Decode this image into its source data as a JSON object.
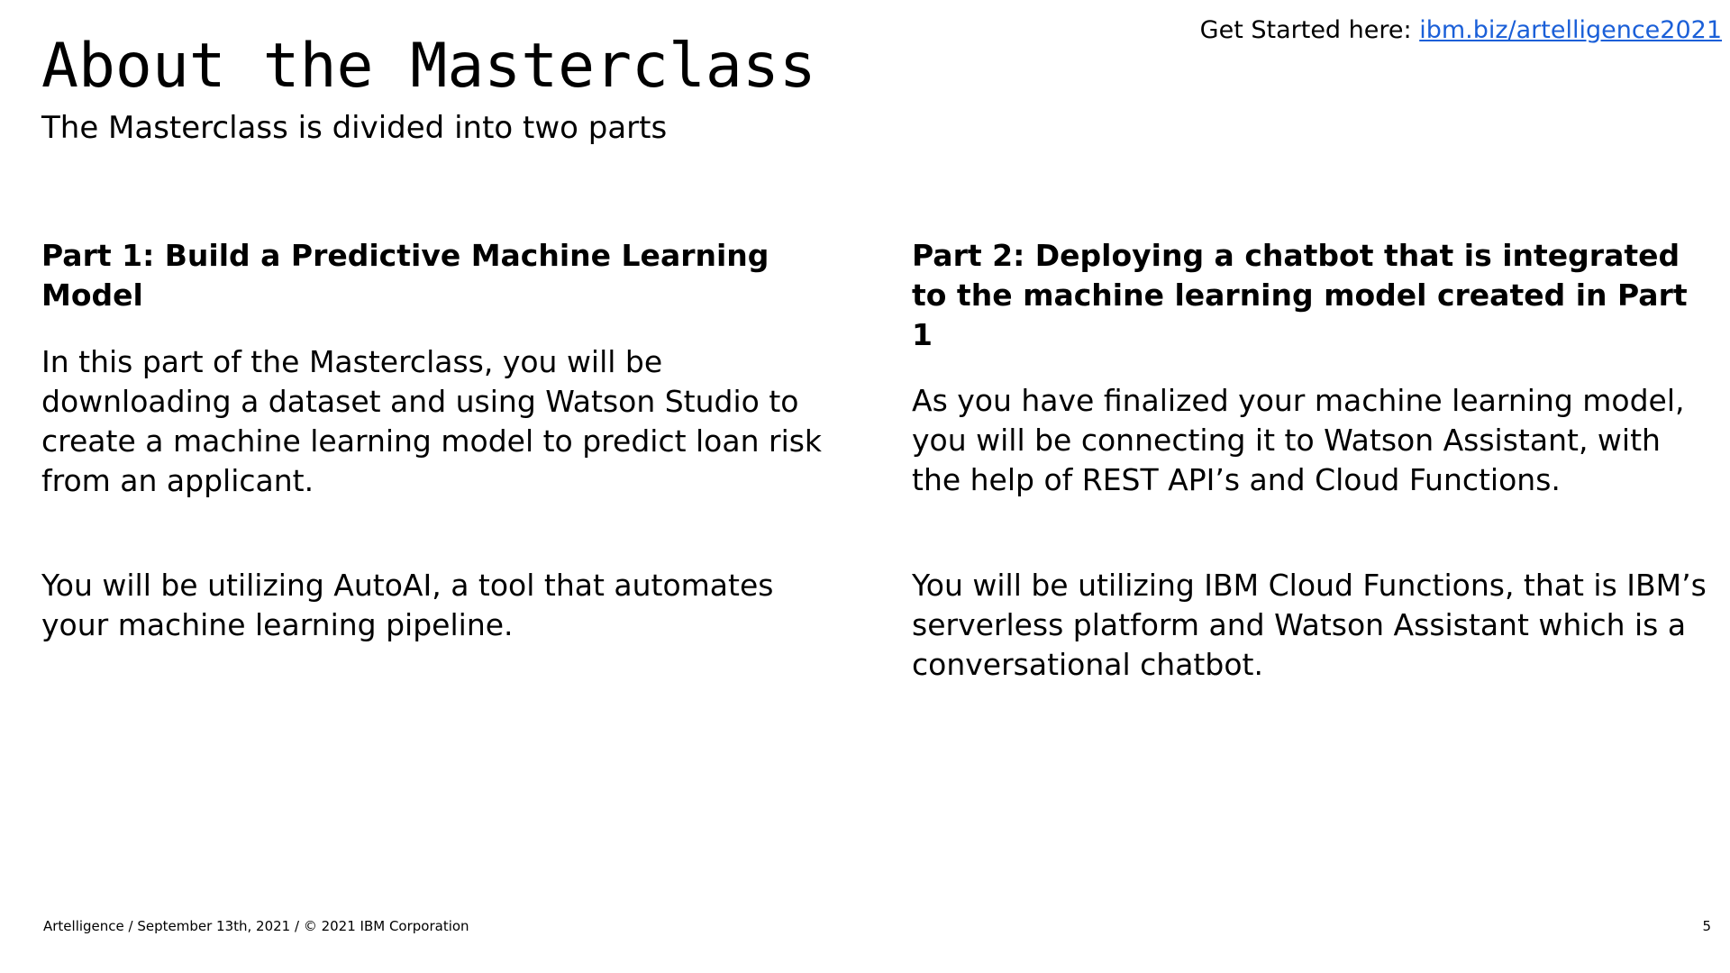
{
  "header": {
    "get_started_label": "Get Started here:",
    "get_started_link": "ibm.biz/artelligence2021"
  },
  "title": "About the Masterclass",
  "subtitle": "The Masterclass is divided into two parts",
  "part1": {
    "heading": "Part 1: Build a Predictive Machine Learning Model",
    "paragraph1": "In this part of the Masterclass, you will be downloading a dataset and using Watson Studio to create a machine learning model to predict loan risk from an applicant.",
    "paragraph2": "You will be utilizing AutoAI, a tool that automates your machine learning pipeline."
  },
  "part2": {
    "heading": "Part 2: Deploying a chatbot that is integrated to the machine learning model created in Part 1",
    "paragraph1": "As you have finalized your machine learning model, you will be connecting it to Watson Assistant, with the help of REST API’s and Cloud Functions.",
    "paragraph2": "You will be utilizing IBM Cloud Functions, that is IBM’s serverless platform and Watson Assistant which is a conversational chatbot."
  },
  "footer": {
    "text": "Artelligence / September 13th, 2021 / © 2021 IBM Corporation",
    "page_number": "5"
  },
  "colors": {
    "link": "#1a5fd8",
    "text": "#000000",
    "background": "#ffffff"
  }
}
